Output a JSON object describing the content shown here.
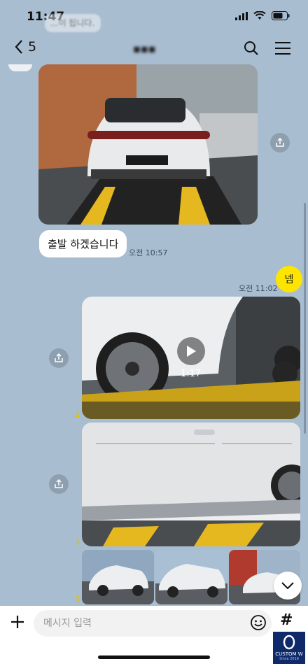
{
  "status": {
    "time": "11:47"
  },
  "header": {
    "back_count": "5",
    "title": "▪▪▪"
  },
  "ghost_text": "...이 됩니다.",
  "messages": {
    "incoming_text": "출발 하겠습니다",
    "incoming_time": "오전 10:57",
    "outgoing_text": "넴",
    "outgoing_time": "오전 11:02",
    "video_duration": "1:17",
    "unread_1": "1",
    "unread_2": "1",
    "unread_3": "1"
  },
  "input": {
    "placeholder": "메시지 입력",
    "hash": "#"
  },
  "logo": {
    "line1": "CUSTOM W",
    "line2": "Since 2016"
  },
  "colors": {
    "background": "#a9bdd1",
    "bubble_out": "#fee500",
    "bubble_in": "#ffffff"
  }
}
